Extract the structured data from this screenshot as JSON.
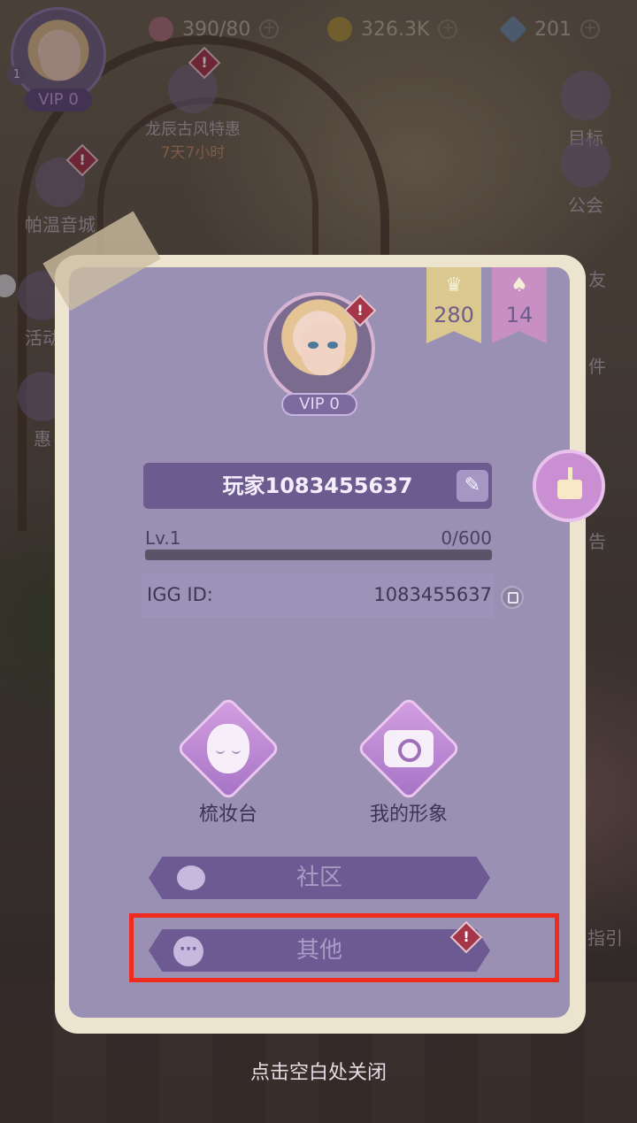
{
  "top_bar": {
    "level": "1",
    "vip": "VIP 0",
    "hearts": "390/80",
    "coins": "326.3K",
    "diamonds": "201"
  },
  "side_left": [
    {
      "label": "龙辰古风特惠",
      "sub": "7天7小时"
    },
    {
      "label": "帕温音城"
    },
    {
      "label": "活动"
    },
    {
      "label": "惠"
    }
  ],
  "side_right": [
    {
      "label": "目标"
    },
    {
      "label": "公会"
    },
    {
      "label": "友"
    },
    {
      "label": "件"
    },
    {
      "label": "告"
    },
    {
      "label": "指引"
    }
  ],
  "panel": {
    "ribbons": {
      "crown_count": "280",
      "outfit_count": "14"
    },
    "vip": "VIP 0",
    "player_name": "玩家1083455637",
    "level_label": "Lv.1",
    "xp_text": "0/600",
    "xp_fraction": 0,
    "igg_label": "IGG ID:",
    "igg_value": "1083455637",
    "dressing_table": "梳妆台",
    "my_look": "我的形象",
    "community": "社区",
    "other": "其他"
  },
  "close_hint": "点击空白处关闭",
  "colors": {
    "panel_bg": "#9990b4",
    "panel_border": "#ece4cf",
    "button_purple": "#6d5a93",
    "highlight_red": "#f02a1f"
  }
}
